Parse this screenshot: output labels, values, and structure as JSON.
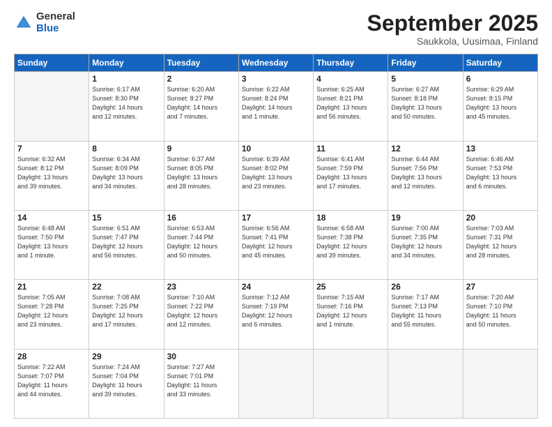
{
  "logo": {
    "general": "General",
    "blue": "Blue"
  },
  "header": {
    "month": "September 2025",
    "location": "Saukkola, Uusimaa, Finland"
  },
  "weekdays": [
    "Sunday",
    "Monday",
    "Tuesday",
    "Wednesday",
    "Thursday",
    "Friday",
    "Saturday"
  ],
  "weeks": [
    [
      {
        "day": "",
        "info": ""
      },
      {
        "day": "1",
        "info": "Sunrise: 6:17 AM\nSunset: 8:30 PM\nDaylight: 14 hours\nand 12 minutes."
      },
      {
        "day": "2",
        "info": "Sunrise: 6:20 AM\nSunset: 8:27 PM\nDaylight: 14 hours\nand 7 minutes."
      },
      {
        "day": "3",
        "info": "Sunrise: 6:22 AM\nSunset: 8:24 PM\nDaylight: 14 hours\nand 1 minute."
      },
      {
        "day": "4",
        "info": "Sunrise: 6:25 AM\nSunset: 8:21 PM\nDaylight: 13 hours\nand 56 minutes."
      },
      {
        "day": "5",
        "info": "Sunrise: 6:27 AM\nSunset: 8:18 PM\nDaylight: 13 hours\nand 50 minutes."
      },
      {
        "day": "6",
        "info": "Sunrise: 6:29 AM\nSunset: 8:15 PM\nDaylight: 13 hours\nand 45 minutes."
      }
    ],
    [
      {
        "day": "7",
        "info": "Sunrise: 6:32 AM\nSunset: 8:12 PM\nDaylight: 13 hours\nand 39 minutes."
      },
      {
        "day": "8",
        "info": "Sunrise: 6:34 AM\nSunset: 8:09 PM\nDaylight: 13 hours\nand 34 minutes."
      },
      {
        "day": "9",
        "info": "Sunrise: 6:37 AM\nSunset: 8:05 PM\nDaylight: 13 hours\nand 28 minutes."
      },
      {
        "day": "10",
        "info": "Sunrise: 6:39 AM\nSunset: 8:02 PM\nDaylight: 13 hours\nand 23 minutes."
      },
      {
        "day": "11",
        "info": "Sunrise: 6:41 AM\nSunset: 7:59 PM\nDaylight: 13 hours\nand 17 minutes."
      },
      {
        "day": "12",
        "info": "Sunrise: 6:44 AM\nSunset: 7:56 PM\nDaylight: 13 hours\nand 12 minutes."
      },
      {
        "day": "13",
        "info": "Sunrise: 6:46 AM\nSunset: 7:53 PM\nDaylight: 13 hours\nand 6 minutes."
      }
    ],
    [
      {
        "day": "14",
        "info": "Sunrise: 6:48 AM\nSunset: 7:50 PM\nDaylight: 13 hours\nand 1 minute."
      },
      {
        "day": "15",
        "info": "Sunrise: 6:51 AM\nSunset: 7:47 PM\nDaylight: 12 hours\nand 56 minutes."
      },
      {
        "day": "16",
        "info": "Sunrise: 6:53 AM\nSunset: 7:44 PM\nDaylight: 12 hours\nand 50 minutes."
      },
      {
        "day": "17",
        "info": "Sunrise: 6:56 AM\nSunset: 7:41 PM\nDaylight: 12 hours\nand 45 minutes."
      },
      {
        "day": "18",
        "info": "Sunrise: 6:58 AM\nSunset: 7:38 PM\nDaylight: 12 hours\nand 39 minutes."
      },
      {
        "day": "19",
        "info": "Sunrise: 7:00 AM\nSunset: 7:35 PM\nDaylight: 12 hours\nand 34 minutes."
      },
      {
        "day": "20",
        "info": "Sunrise: 7:03 AM\nSunset: 7:31 PM\nDaylight: 12 hours\nand 28 minutes."
      }
    ],
    [
      {
        "day": "21",
        "info": "Sunrise: 7:05 AM\nSunset: 7:28 PM\nDaylight: 12 hours\nand 23 minutes."
      },
      {
        "day": "22",
        "info": "Sunrise: 7:08 AM\nSunset: 7:25 PM\nDaylight: 12 hours\nand 17 minutes."
      },
      {
        "day": "23",
        "info": "Sunrise: 7:10 AM\nSunset: 7:22 PM\nDaylight: 12 hours\nand 12 minutes."
      },
      {
        "day": "24",
        "info": "Sunrise: 7:12 AM\nSunset: 7:19 PM\nDaylight: 12 hours\nand 6 minutes."
      },
      {
        "day": "25",
        "info": "Sunrise: 7:15 AM\nSunset: 7:16 PM\nDaylight: 12 hours\nand 1 minute."
      },
      {
        "day": "26",
        "info": "Sunrise: 7:17 AM\nSunset: 7:13 PM\nDaylight: 11 hours\nand 55 minutes."
      },
      {
        "day": "27",
        "info": "Sunrise: 7:20 AM\nSunset: 7:10 PM\nDaylight: 11 hours\nand 50 minutes."
      }
    ],
    [
      {
        "day": "28",
        "info": "Sunrise: 7:22 AM\nSunset: 7:07 PM\nDaylight: 11 hours\nand 44 minutes."
      },
      {
        "day": "29",
        "info": "Sunrise: 7:24 AM\nSunset: 7:04 PM\nDaylight: 11 hours\nand 39 minutes."
      },
      {
        "day": "30",
        "info": "Sunrise: 7:27 AM\nSunset: 7:01 PM\nDaylight: 11 hours\nand 33 minutes."
      },
      {
        "day": "",
        "info": ""
      },
      {
        "day": "",
        "info": ""
      },
      {
        "day": "",
        "info": ""
      },
      {
        "day": "",
        "info": ""
      }
    ]
  ]
}
